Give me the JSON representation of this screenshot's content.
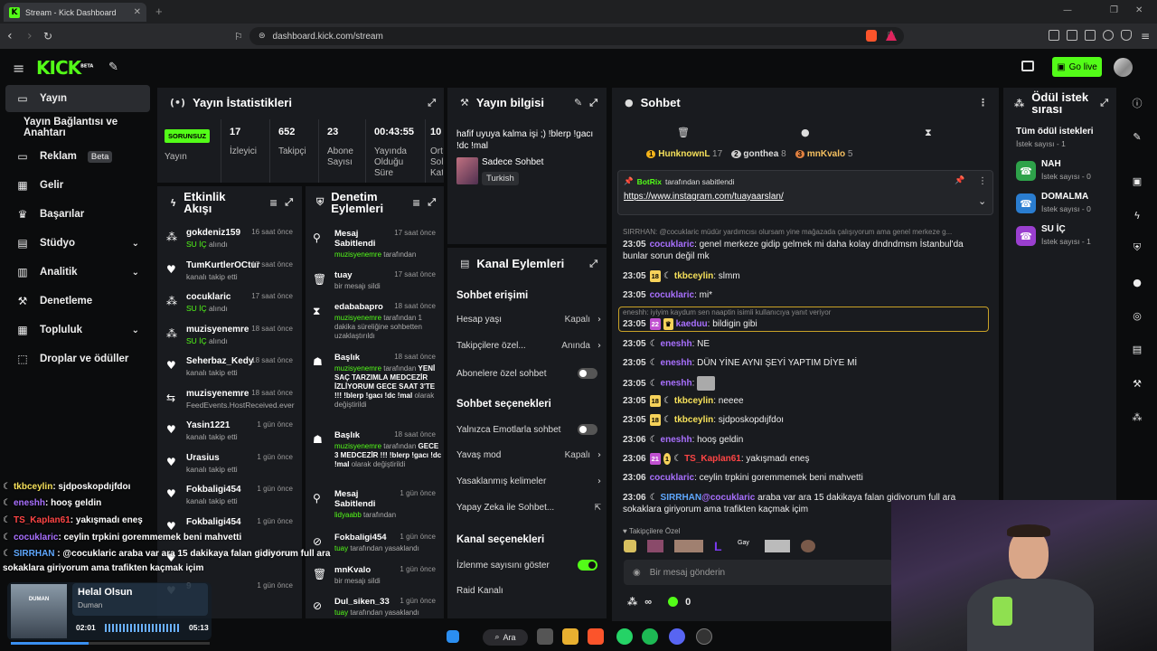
{
  "browser": {
    "tab_title": "Stream - Kick Dashboard",
    "url": "dashboard.kick.com/stream"
  },
  "header": {
    "logo": "KICK",
    "logo_tag": "BETA",
    "go_live": "Go live"
  },
  "nav": {
    "items": [
      {
        "label": "Yayın",
        "icon": "broadcast-icon"
      },
      {
        "label": "Yayın Bağlantısı ve Anahtarı"
      },
      {
        "label": "Reklam",
        "badge": "Beta",
        "icon": "tv-icon"
      },
      {
        "label": "Gelir",
        "icon": "chart-icon"
      },
      {
        "label": "Başarılar",
        "icon": "trophy-icon"
      },
      {
        "label": "Stüdyo",
        "icon": "studio-icon"
      },
      {
        "label": "Analitik",
        "icon": "analytics-icon"
      },
      {
        "label": "Denetleme",
        "icon": "wrench-icon"
      },
      {
        "label": "Topluluk",
        "icon": "community-icon"
      },
      {
        "label": "Droplar ve ödüller",
        "icon": "drops-icon"
      }
    ]
  },
  "stats": {
    "title": "Yayın İstatistikleri",
    "status_badge": "SORUNSUZ",
    "status_label": "Yayın",
    "items": [
      {
        "value": "17",
        "label": "İzleyici"
      },
      {
        "value": "652",
        "label": "Takipçi"
      },
      {
        "value": "23",
        "label": "Abone Sayısı"
      },
      {
        "value": "00:43:55",
        "label": "Yayında Olduğu Süre"
      },
      {
        "value": "10",
        "label": "Ort Sol Kat"
      }
    ]
  },
  "activity": {
    "title": "Etkinlik Akışı",
    "items": [
      {
        "name": "gokdeniz159",
        "time": "16 saat önce",
        "sub": "SU İÇ",
        "sub2": "alındı",
        "icon": "points-icon"
      },
      {
        "name": "TumKurtlerOCtur",
        "time": "17 saat önce",
        "sub": "kanalı takip etti",
        "icon": "heart-icon"
      },
      {
        "name": "cocuklaric",
        "time": "17 saat önce",
        "sub": "SU İÇ",
        "sub2": "alındı",
        "icon": "points-icon"
      },
      {
        "name": "muzisyenemre",
        "time": "18 saat önce",
        "sub": "SU İÇ",
        "sub2": "alındı",
        "icon": "points-icon"
      },
      {
        "name": "Seherbaz_Kedy",
        "time": "18 saat önce",
        "sub": "kanalı takip etti",
        "icon": "heart-icon"
      },
      {
        "name": "muzisyenemre",
        "time": "18 saat önce",
        "sub": "FeedEvents.HostReceived.ever",
        "icon": "host-icon"
      },
      {
        "name": "Yasin1221",
        "time": "1 gün önce",
        "sub": "kanalı takip etti",
        "icon": "heart-icon"
      },
      {
        "name": "Urasius",
        "time": "1 gün önce",
        "sub": "kanalı takip etti",
        "icon": "heart-icon"
      },
      {
        "name": "Fokbaligi454",
        "time": "1 gün önce",
        "sub": "kanalı takip etti",
        "icon": "heart-icon"
      },
      {
        "name": "Fokbaligi454",
        "time": "1 gün önce",
        "sub": "",
        "icon": "heart-icon"
      },
      {
        "name": "",
        "time": "1 gün önce",
        "sub": "",
        "icon": "heart-icon"
      },
      {
        "name": "9",
        "time": "1 gün önce",
        "sub": "",
        "icon": "heart-icon"
      }
    ]
  },
  "moderation": {
    "title": "Denetim Eylemleri",
    "items": [
      {
        "name": "Mesaj Sabitlendi",
        "time": "17 saat önce",
        "actor": "muzisyenemre",
        "sub": "tarafından",
        "icon": "pin-icon"
      },
      {
        "name": "tuay",
        "time": "17 saat önce",
        "actor": "",
        "sub": "bir mesajı sildi",
        "icon": "trash-icon"
      },
      {
        "name": "edababapro",
        "time": "18 saat önce",
        "actor": "muzisyenemre",
        "sub": "tarafından 1 dakika süreliğine sohbetten uzaklaştırıldı",
        "icon": "hourglass-icon"
      },
      {
        "name": "Başlık",
        "time": "18 saat önce",
        "actor": "muzisyenemre",
        "sub": "tarafından",
        "quote": "YENİ SAÇ TARZIMLA MEDCEZİR İZLİYORUM GECE SAAT 3'TE !!! !blerp !gacı !dc !mal",
        "sub2": "olarak değiştirildi",
        "icon": "title-icon"
      },
      {
        "name": "Başlık",
        "time": "18 saat önce",
        "actor": "muzisyenemre",
        "sub": "tarafından",
        "quote": "GECE 3 MEDCEZİR !!! !blerp !gacı !dc !mal",
        "sub2": "olarak değiştirildi",
        "icon": "title-icon"
      },
      {
        "name": "Mesaj Sabitlendi",
        "time": "1 gün önce",
        "actor": "lidyaabb",
        "sub": "tarafından",
        "icon": "pin-icon"
      },
      {
        "name": "Fokbaligi454",
        "time": "1 gün önce",
        "actor": "tuay",
        "sub": "tarafından yasaklandı",
        "icon": "ban-icon"
      },
      {
        "name": "mnKvalo",
        "time": "1 gün önce",
        "actor": "",
        "sub": "bir mesajı sildi",
        "icon": "trash-icon"
      },
      {
        "name": "Dul_siken_33",
        "time": "1 gün önce",
        "actor": "tuay",
        "sub": "tarafından yasaklandı",
        "icon": "ban-icon"
      }
    ]
  },
  "info": {
    "title": "Yayın bilgisi",
    "stream_title": "hafif uyuya kalma işi ;) !blerp !gacı !dc !mal",
    "category": "Sadece Sohbet",
    "language": "Turkish"
  },
  "channel": {
    "title": "Kanal Eylemleri",
    "chat_access": "Sohbet erişimi",
    "account_age": "Hesap yaşı",
    "account_age_val": "Kapalı",
    "followers": "Takipçilere özel...",
    "followers_val": "Anında",
    "subs_only": "Abonelere özel sohbet",
    "chat_options": "Sohbet seçenekleri",
    "emotes_only": "Yalnızca Emotlarla sohbet",
    "slow_mode": "Yavaş mod",
    "slow_mode_val": "Kapalı",
    "banned_words": "Yasaklanmış kelimeler",
    "ai_chat": "Yapay Zeka ile Sohbet...",
    "channel_options": "Kanal seçenekleri",
    "show_viewers": "İzlenme sayısını göster",
    "raid": "Raid Kanalı"
  },
  "chat": {
    "title": "Sohbet",
    "top": [
      {
        "rank": "1",
        "name": "HunknownL",
        "count": "17"
      },
      {
        "rank": "2",
        "name": "gonthea",
        "count": "8"
      },
      {
        "rank": "3",
        "name": "mnKvalo",
        "count": "5"
      }
    ],
    "pinned_by": "BotRix",
    "pinned_suffix": "tarafından sabitlendi",
    "pinned_link": "https://www.instagram.com/tuayaarslan/",
    "reply1": "SIRRHAN: @cocuklaric müdür yardımcısı olursam yine mağazada çalışıyorum ama genel merkeze g...",
    "messages": [
      {
        "t": "23:05",
        "user": "cocuklaric",
        "text": ": genel merkeze gidip gelmek mi daha kolay dndndmsm İstanbul'da bunlar sorun değil mk"
      },
      {
        "t": "23:05",
        "user": "tkbceylin",
        "text": ": slmm"
      },
      {
        "t": "23:05",
        "user": "cocuklaric",
        "text": ": mi*"
      },
      {
        "t": "23:05",
        "user": "kaeduu",
        "text": ": bildigin gibi"
      },
      {
        "t": "23:05",
        "user": "eneshh",
        "text": ": NE"
      },
      {
        "t": "23:05",
        "user": "eneshh",
        "text": ": DÜN YİNE AYNI ŞEYİ YAPTIM DİYE Mİ"
      },
      {
        "t": "23:05",
        "user": "eneshh",
        "text": ":"
      },
      {
        "t": "23:05",
        "user": "tkbceylin",
        "text": ": neeee"
      },
      {
        "t": "23:05",
        "user": "tkbceylin",
        "text": ": sjdposkopdıjfdoı"
      },
      {
        "t": "23:06",
        "user": "eneshh",
        "text": ": hooş geldin"
      },
      {
        "t": "23:06",
        "user": "TS_Kaplan61",
        "text": ": yakışmadı eneş"
      },
      {
        "t": "23:06",
        "user": "cocuklaric",
        "text": ": ceylin trpkini goremmemek beni mahvetti"
      },
      {
        "t": "23:06",
        "user": "SIRRHAN",
        "mention": "@cocuklaric",
        "text": " araba var ara 15 dakikaya falan gidiyorum full ara sokaklara giriyorum ama trafikten kaçmak içim"
      }
    ],
    "reply2": "eneshh: iyiyim kaydum sen naaptin isimli kullanıcıya yanıt veriyor",
    "reply2_user": "eneshh",
    "followers_only": "Takipçilere Özel",
    "input_placeholder": "Bir mesaj gönderin",
    "points": "∞",
    "kick_count": "0"
  },
  "rewards": {
    "title": "Ödül istek sırası",
    "all": "Tüm ödül istekleri",
    "count": "İstek sayısı - 1",
    "items": [
      {
        "name": "NAH",
        "sub": "İstek sayısı - 0"
      },
      {
        "name": "DOMALMA",
        "sub": "İstek sayısı - 0"
      },
      {
        "name": "SU İÇ",
        "sub": "İstek sayısı - 1"
      }
    ]
  },
  "overlay": {
    "chat": [
      {
        "user": "tkbceylin",
        "text": ": sjdposkopdıjfdoı"
      },
      {
        "user": "eneshh",
        "text": ": hooş geldin"
      },
      {
        "user": "TS_Kaplan61",
        "text": ": yakışmadı eneş"
      },
      {
        "user": "cocuklaric",
        "text": ": ceylin trpkini goremmemek beni mahvetti"
      },
      {
        "user": "SIRRHAN",
        "text": " : @cocuklaric araba var ara 15 dakikaya falan gidiyorum full ara"
      },
      {
        "text": "sokaklara giriyorum ama trafikten kaçmak içim"
      }
    ],
    "song": "Helal Olsun",
    "artist": "Duman",
    "album": "DUMAN",
    "elapsed": "02:01",
    "total": "05:13",
    "progress": 0.39
  },
  "taskbar": {
    "search": "Ara"
  }
}
